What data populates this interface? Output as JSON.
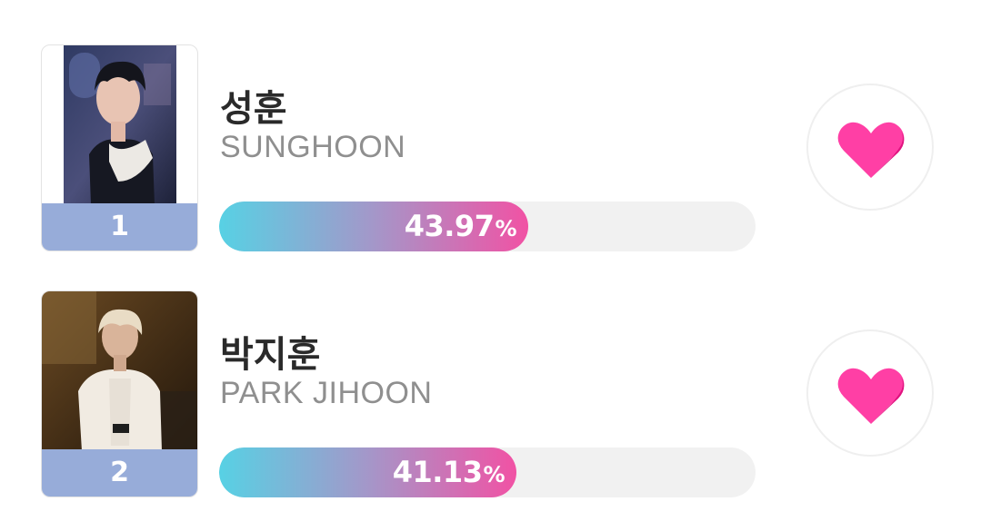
{
  "ranking": [
    {
      "rank": "1",
      "name_ko": "성훈",
      "name_en": "SUNGHOON",
      "percent": "43.97",
      "percent_unit": "%",
      "percent_value": 43.97,
      "photo_description": "portrait photo"
    },
    {
      "rank": "2",
      "name_ko": "박지훈",
      "name_en": "PARK JIHOON",
      "percent": "41.13",
      "percent_unit": "%",
      "percent_value": 41.13,
      "photo_description": "portrait photo"
    }
  ],
  "colors": {
    "rank_bg": "#97acd9",
    "bar_start": "#57d1e4",
    "bar_end": "#f152a4",
    "heart": "#ff3fa5"
  },
  "icons": {
    "vote": "heart-icon"
  }
}
